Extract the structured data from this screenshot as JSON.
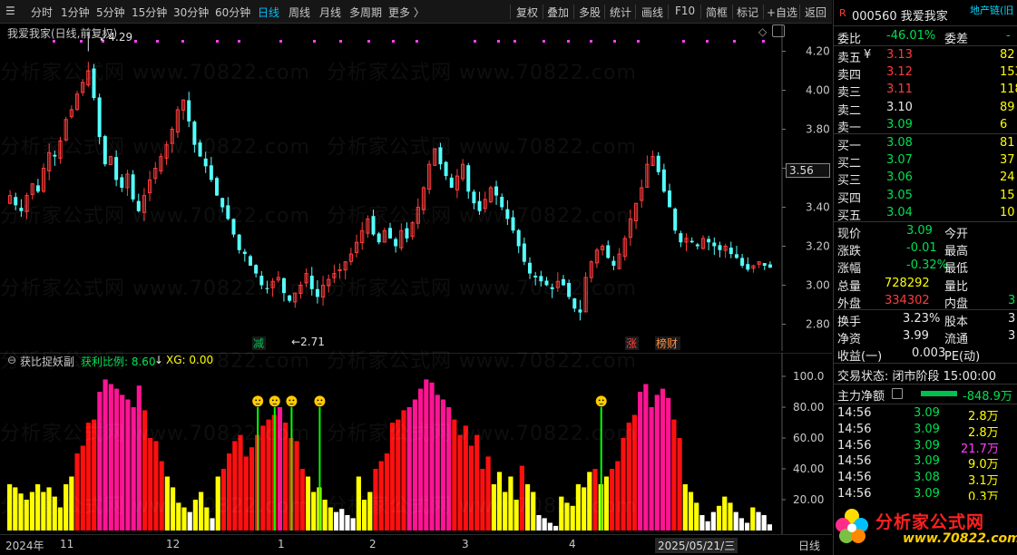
{
  "toolbar": {
    "periods": [
      "分时",
      "1分钟",
      "5分钟",
      "15分钟",
      "30分钟",
      "60分钟",
      "日线",
      "周线",
      "月线",
      "多周期",
      "更多 〉"
    ],
    "active_period": "日线",
    "actions": [
      "复权",
      "叠加",
      "多股",
      "统计",
      "画线",
      "F10",
      "简框",
      "标记",
      "+自选",
      "返回"
    ]
  },
  "main_chart": {
    "title": "我爱我家(日线,前复权)",
    "high_label": "4.29",
    "low_label": "2.71",
    "price_tag": "3.56",
    "y_ticks": [
      "4.20",
      "4.00",
      "3.80",
      "3.60",
      "3.40",
      "3.20",
      "3.00",
      "2.80"
    ],
    "event_marks": [
      {
        "text": "减",
        "color": "#00c050"
      },
      {
        "text": "涨",
        "color": "#ff4040"
      },
      {
        "text": "榜财",
        "color": "#ff8c3c"
      }
    ]
  },
  "sub_chart": {
    "title": "获比捉妖副",
    "ratio_label": "获利比例: 8.60",
    "arrow": "↓",
    "xg_label": "XG: 0.00",
    "y_ticks": [
      "100.0",
      "80.00",
      "60.00",
      "40.00",
      "20.00"
    ]
  },
  "x_axis": {
    "labels": [
      "2024年",
      "11",
      "12",
      "1",
      "2",
      "3",
      "4",
      "2025/05/21/三"
    ],
    "period_label": "日线"
  },
  "watermark": {
    "text": "分析家公式网 www.70822.com",
    "logo_text": "分析家公式网",
    "logo_url": "www.70822.com"
  },
  "quote": {
    "flag": "R",
    "code_name": "000560 我爱我家",
    "industry": "地产链(旧",
    "weibi_label": "委比",
    "weibi_value": "-46.01%",
    "weicha_label": "委差",
    "weicha_value": "-",
    "asks": [
      {
        "label": "卖五",
        "price": "3.13",
        "vol": "82",
        "mark": "¥"
      },
      {
        "label": "卖四",
        "price": "3.12",
        "vol": "153"
      },
      {
        "label": "卖三",
        "price": "3.11",
        "vol": "118"
      },
      {
        "label": "卖二",
        "price": "3.10",
        "vol": "89"
      },
      {
        "label": "卖一",
        "price": "3.09",
        "vol": "6"
      }
    ],
    "bids": [
      {
        "label": "买一",
        "price": "3.08",
        "vol": "81"
      },
      {
        "label": "买二",
        "price": "3.07",
        "vol": "37"
      },
      {
        "label": "买三",
        "price": "3.06",
        "vol": "24"
      },
      {
        "label": "买四",
        "price": "3.05",
        "vol": "15"
      },
      {
        "label": "买五",
        "price": "3.04",
        "vol": "10"
      }
    ],
    "stats": [
      {
        "l1": "现价",
        "v1": "3.09",
        "l2": "今开"
      },
      {
        "l1": "涨跌",
        "v1": "-0.01",
        "l2": "最高"
      },
      {
        "l1": "涨幅",
        "v1": "-0.32%",
        "l2": "最低"
      },
      {
        "l1": "总量",
        "v1": "728292",
        "l2": "量比"
      },
      {
        "l1": "外盘",
        "v1": "334302",
        "l2": "内盘",
        "v2": "3"
      }
    ],
    "stats2": [
      {
        "l1": "换手",
        "v1": "3.23%",
        "l2": "股本",
        "v2": "3"
      },
      {
        "l1": "净资",
        "v1": "3.99",
        "l2": "流通",
        "v2": "3"
      },
      {
        "l1": "收益(一)",
        "v1": "0.003",
        "l2": "PE(动)"
      }
    ],
    "trade_status": "交易状态: 闭市阶段 15:00:00",
    "main_flow_label": "主力净额",
    "main_flow_value": "-848.9万",
    "ticks": [
      {
        "t": "14:56",
        "p": "3.09",
        "v": "2.8万"
      },
      {
        "t": "14:56",
        "p": "3.09",
        "v": "2.8万"
      },
      {
        "t": "14:56",
        "p": "3.09",
        "v": "21.7万"
      },
      {
        "t": "14:56",
        "p": "3.09",
        "v": "9.0万"
      },
      {
        "t": "14:56",
        "p": "3.08",
        "v": "3.1万"
      },
      {
        "t": "14:56",
        "p": "3.09",
        "v": "0.3万"
      }
    ]
  },
  "colors": {
    "up": "#ff3c3c",
    "down": "#54ffff",
    "red_bar": "#ff1010",
    "pink_bar": "#ff1493",
    "yellow_bar": "#ffff00",
    "green_line": "#00ff00"
  },
  "chart_data": [
    {
      "type": "candlestick",
      "ylim": [
        2.71,
        4.29
      ],
      "close": [
        3.46,
        3.41,
        3.38,
        3.46,
        3.52,
        3.48,
        3.6,
        3.68,
        3.66,
        3.74,
        3.85,
        3.9,
        3.98,
        4.04,
        4.1,
        3.96,
        3.76,
        3.62,
        3.66,
        3.54,
        3.5,
        3.57,
        3.44,
        3.38,
        3.46,
        3.54,
        3.6,
        3.66,
        3.72,
        3.8,
        3.9,
        3.95,
        3.84,
        3.72,
        3.66,
        3.61,
        3.54,
        3.46,
        3.4,
        3.34,
        3.26,
        3.18,
        3.16,
        3.1,
        3.06,
        3.0,
        2.98,
        3.02,
        3.04,
        2.96,
        2.92,
        2.96,
        3.0,
        3.06,
        2.98,
        2.94,
        3.0,
        3.03,
        3.06,
        3.08,
        3.12,
        3.16,
        3.22,
        3.28,
        3.34,
        3.26,
        3.22,
        3.28,
        3.24,
        3.2,
        3.28,
        3.24,
        3.32,
        3.4,
        3.5,
        3.62,
        3.7,
        3.62,
        3.56,
        3.5,
        3.56,
        3.62,
        3.48,
        3.42,
        3.38,
        3.44,
        3.5,
        3.46,
        3.4,
        3.34,
        3.28,
        3.2,
        3.12,
        3.06,
        3.04,
        3.02,
        3.0,
        2.98,
        3.02,
        3.0,
        2.94,
        2.88,
        2.86,
        3.04,
        3.12,
        3.18,
        3.2,
        3.14,
        3.1,
        3.16,
        3.24,
        3.34,
        3.42,
        3.5,
        3.62,
        3.66,
        3.58,
        3.48,
        3.4,
        3.28,
        3.22,
        3.24,
        3.22,
        3.2,
        3.24,
        3.22,
        3.2,
        3.18,
        3.2,
        3.16,
        3.14,
        3.1,
        3.08,
        3.1,
        3.12,
        3.1,
        3.09
      ],
      "x_labels": [
        "2024年",
        "11",
        "12",
        "1",
        "2",
        "3",
        "4",
        "2025/05/21/三"
      ],
      "y_ticks": [
        4.2,
        4.0,
        3.8,
        3.6,
        3.4,
        3.2,
        3.0,
        2.8
      ]
    },
    {
      "type": "bar",
      "ylim": [
        0,
        105
      ],
      "values": [
        30,
        28,
        24,
        20,
        25,
        30,
        25,
        28,
        22,
        15,
        30,
        35,
        50,
        55,
        70,
        72,
        90,
        98,
        95,
        92,
        88,
        85,
        80,
        94,
        78,
        60,
        58,
        45,
        35,
        28,
        18,
        15,
        12,
        20,
        25,
        15,
        8,
        35,
        40,
        50,
        58,
        62,
        48,
        54,
        62,
        68,
        72,
        75,
        80,
        70,
        60,
        58,
        40,
        35,
        25,
        28,
        20,
        15,
        12,
        14,
        10,
        8,
        35,
        20,
        25,
        40,
        45,
        50,
        70,
        72,
        78,
        80,
        85,
        92,
        98,
        96,
        88,
        85,
        80,
        72,
        62,
        68,
        55,
        62,
        40,
        48,
        30,
        38,
        25,
        35,
        20,
        42,
        30,
        25,
        10,
        8,
        5,
        3,
        22,
        18,
        16,
        30,
        28,
        38,
        40,
        30,
        35,
        40,
        45,
        60,
        70,
        75,
        90,
        95,
        80,
        88,
        92,
        86,
        72,
        60,
        30,
        25,
        18,
        10,
        6,
        12,
        16,
        22,
        18,
        12,
        8,
        5,
        15,
        12,
        10,
        4
      ],
      "colors_by_index": "red/pink/yellow/white per bar",
      "y_ticks": [
        100,
        80,
        60,
        40,
        20
      ]
    }
  ]
}
